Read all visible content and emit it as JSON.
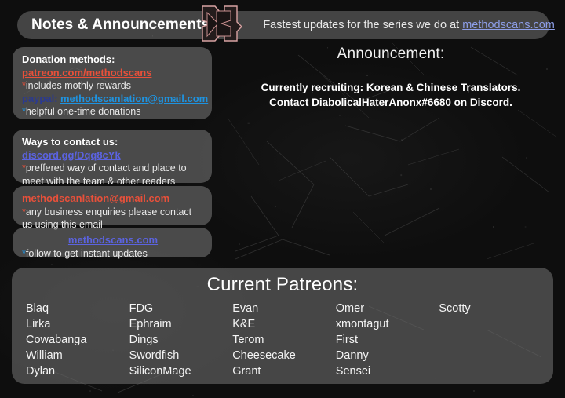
{
  "header": {
    "title": "Notes & Announcements",
    "logo_icon": "methodscans-arrow-logo",
    "tagline_prefix": "Fastest updates for the series we do at ",
    "tagline_link": "methodscans.com"
  },
  "boxes": {
    "donation": {
      "title": "Donation methods:",
      "patreon_link": "patreon.com/methodscans",
      "patreon_note_asterisk": "*",
      "patreon_note": "includes mothly rewards",
      "paypal_label": "paypal:",
      "paypal_email": "methodscanlation@gmail.com",
      "paypal_note_asterisk": "*",
      "paypal_note": "helpful one-time donations"
    },
    "contact": {
      "title": "Ways to contact us:",
      "discord_link": "discord.gg/Dqq8cYk",
      "note_asterisk": "*",
      "note": "preffered way of contact and place to meet with the team & other readers"
    },
    "email": {
      "email_link": "methodscanlation@gmail.com",
      "note_asterisk": "*",
      "note": "any business enquiries please contact us using this email"
    },
    "site": {
      "site_link": "methodscans.com",
      "note_asterisk": "*",
      "note": "follow to get instant updates"
    }
  },
  "announcement": {
    "heading": "Announcement:",
    "line1": "Currently recruiting: Korean & Chinese Translators.",
    "line2": "Contact DiabolicalHaterAnonx#6680 on Discord."
  },
  "patreons": {
    "title": "Current Patreons:",
    "columns": [
      [
        "Blaq",
        "Lirka",
        "Cowabanga",
        "William",
        "Dylan"
      ],
      [
        "FDG",
        "Ephraim",
        "Dings",
        "Swordfish",
        "SiliconMage"
      ],
      [
        "Evan",
        "K&E",
        "Terom",
        "Cheesecake",
        "Grant"
      ],
      [
        "Omer",
        "xmontagut",
        "First",
        "Danny",
        "Sensei"
      ],
      [
        "Scotty"
      ]
    ]
  },
  "colors": {
    "background": "#0e0e0e",
    "panel": "#707070",
    "patreon_red": "#e8503a",
    "paypal_blue": "#1e93e0",
    "paypal_navy": "#2b3a8f",
    "discord_purple": "#5b63e0",
    "link_lavender": "#8d9ee8",
    "logo_outline": "#d8a0a0",
    "text": "#eaeaea"
  }
}
